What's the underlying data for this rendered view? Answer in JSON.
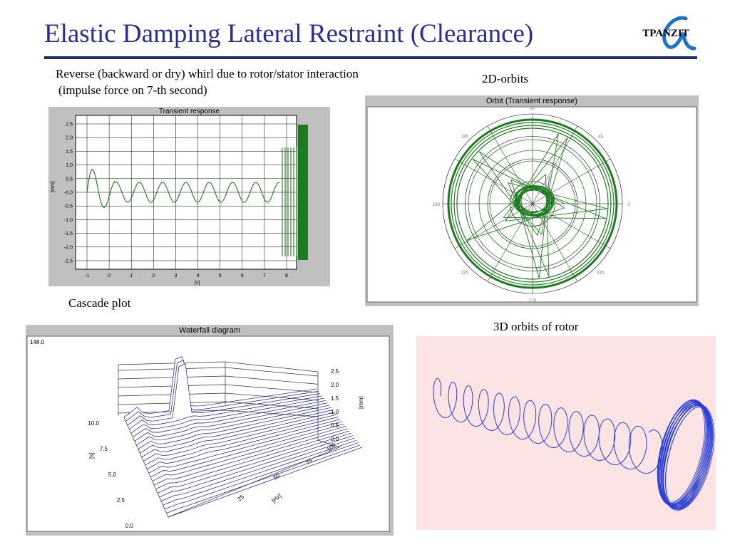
{
  "title": "Elastic Damping Lateral Restraint (Clearance)",
  "logo": {
    "text": "TPANZIT",
    "symbol": "α",
    "accent_color": "#1a73c8"
  },
  "captions": {
    "reverse_whirl_line1": "Reverse (backward or dry) whirl due to rotor/stator interaction",
    "reverse_whirl_line2": "(impulse force on 7-th second)",
    "orbits_2d": "2D-orbits",
    "cascade": "Cascade plot",
    "orbits_3d": "3D orbits of rotor"
  },
  "transient": {
    "header": "Transient response",
    "ylabel": "[mm]",
    "xlabel": "[s]",
    "yticks": [
      "2.5",
      "2.0",
      "1.5",
      "1.0",
      "0.5",
      "-0.0",
      "-0.5",
      "-1.0",
      "-1.5",
      "-2.0",
      "-2.5"
    ],
    "xticks": [
      "-1",
      "0",
      "1",
      "2",
      "3",
      "4",
      "5",
      "6",
      "7",
      "8"
    ],
    "line_color": "#1e7a1e"
  },
  "orbit": {
    "header": "Orbit (Transient response)",
    "angle_labels": [
      "0",
      "45",
      "90",
      "135",
      "180",
      "225",
      "270",
      "315"
    ],
    "line_color": "#1e7a1e"
  },
  "waterfall": {
    "header": "Waterfall diagram",
    "corner_value": "148.0",
    "z_ticks": [
      "2.5",
      "2.0",
      "1.5",
      "1.0",
      "0.5",
      "0.0"
    ],
    "z_label": "[mm]",
    "time_ticks": [
      "10.0",
      "7.5",
      "5.0",
      "2.5",
      "0.0"
    ],
    "time_label": "[s]",
    "freq_ticks": [
      "100",
      "75",
      "50",
      "25"
    ],
    "freq_label": "[Hz]",
    "mesh_color": "#1a1a8c"
  },
  "orbits3d": {
    "bg_color": "#fce4e4",
    "line_color": "#2a3fd8"
  },
  "colors": {
    "title": "#2b2b9a",
    "rule": "#1f2a78",
    "panel": "#c0c0c0"
  }
}
